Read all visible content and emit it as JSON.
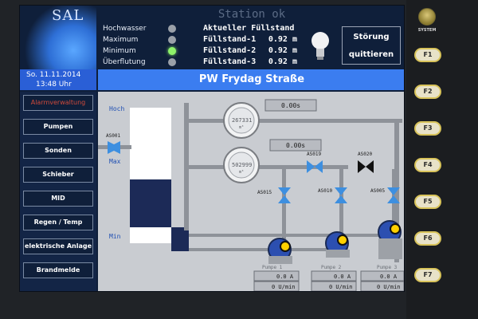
{
  "logo": "SAL",
  "station_status": "Station ok",
  "levels": [
    {
      "label": "Hochwasser",
      "state": "off"
    },
    {
      "label": "Maximum",
      "state": "off"
    },
    {
      "label": "Minimum",
      "state": "on"
    },
    {
      "label": "Überflutung",
      "state": "off"
    }
  ],
  "fill": {
    "title": "Aktueller Füllstand",
    "rows": [
      {
        "label": "Füllstand-1",
        "value": "0.92 m"
      },
      {
        "label": "Füllstand-2",
        "value": "0.92 m"
      },
      {
        "label": "Füllstand-3",
        "value": "0.92 m"
      }
    ]
  },
  "ack_button": {
    "line1": "Störung",
    "line2": "quittieren"
  },
  "date": "So. 11.11.2014",
  "time": "13:48 Uhr",
  "page_title": "PW Frydag Straße",
  "nav": [
    {
      "label": "Alarmverwaltung"
    },
    {
      "label": "Pumpen"
    },
    {
      "label": "Sonden"
    },
    {
      "label": "Schieber"
    },
    {
      "label": "MID"
    },
    {
      "label": "Regen / Temp"
    },
    {
      "label": "elektrische Anlage"
    },
    {
      "label": "Brandmelde"
    }
  ],
  "schematic": {
    "tank_labels": {
      "hoch": "Hoch",
      "max": "Max",
      "min": "Min"
    },
    "meters": [
      {
        "value": "267331",
        "unit": "m³"
      },
      {
        "value": "502999",
        "unit": "m³"
      }
    ],
    "timers": [
      "0.00s",
      "0.00s"
    ],
    "valves": [
      "AS001",
      "AS019",
      "AS020",
      "AS015",
      "AS010",
      "AS005"
    ],
    "pumps": [
      {
        "name": "Pumpe 1",
        "current": "0.0 A",
        "speed": "0 U/min"
      },
      {
        "name": "Pumpe 2",
        "current": "0.0 A",
        "speed": "0 U/min"
      },
      {
        "name": "Pumpe 3",
        "current": "0.0 A",
        "speed": "0 U/min"
      }
    ]
  },
  "side_keys": {
    "system_label": "SYSTEM",
    "f_keys": [
      "F1",
      "F2",
      "F3",
      "F4",
      "F5",
      "F6",
      "F7"
    ]
  },
  "colors": {
    "header_blue": "#3b7df0",
    "screen_bg": "#0f1f3a",
    "schematic_bg": "#c9ccd1",
    "valve_blue": "#3d8fe0",
    "led_green": "#8ef26a",
    "alarm_red": "#cf4a3a",
    "fkey_ring": "#d8c35a"
  }
}
